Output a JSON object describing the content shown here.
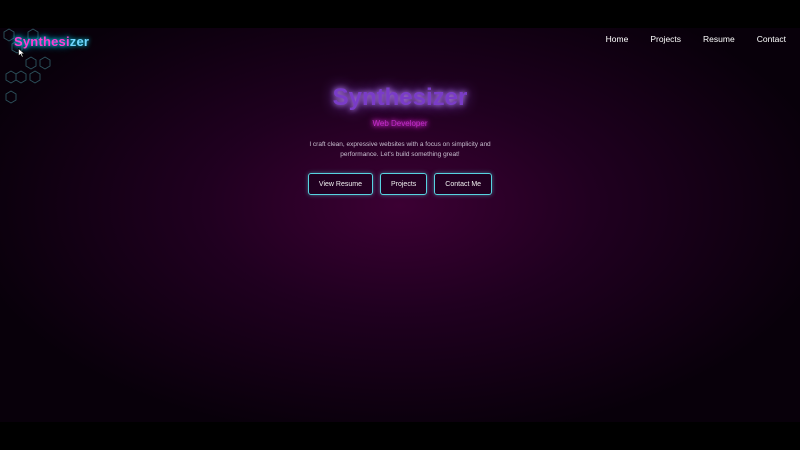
{
  "app": {
    "logo_main": "Synthesi",
    "logo_tail": "zer"
  },
  "nav": {
    "items": [
      {
        "label": "Home"
      },
      {
        "label": "Projects"
      },
      {
        "label": "Resume"
      },
      {
        "label": "Contact"
      }
    ]
  },
  "hero": {
    "title": "Synthesizer",
    "subtitle": "Web Developer",
    "description": "I craft clean, expressive websites with a focus on simplicity and performance. Let's build something great!"
  },
  "actions": {
    "view_resume": "View Resume",
    "projects": "Projects",
    "contact": "Contact Me"
  },
  "colors": {
    "accent_cyan": "#57d3e0",
    "accent_magenta": "#ff3cd2",
    "title_purple": "#7a3cc8",
    "background_deep": "#140014"
  },
  "icons": {
    "cursor": "mouse-pointer-icon",
    "decor": "hexagon-grid-decoration"
  }
}
